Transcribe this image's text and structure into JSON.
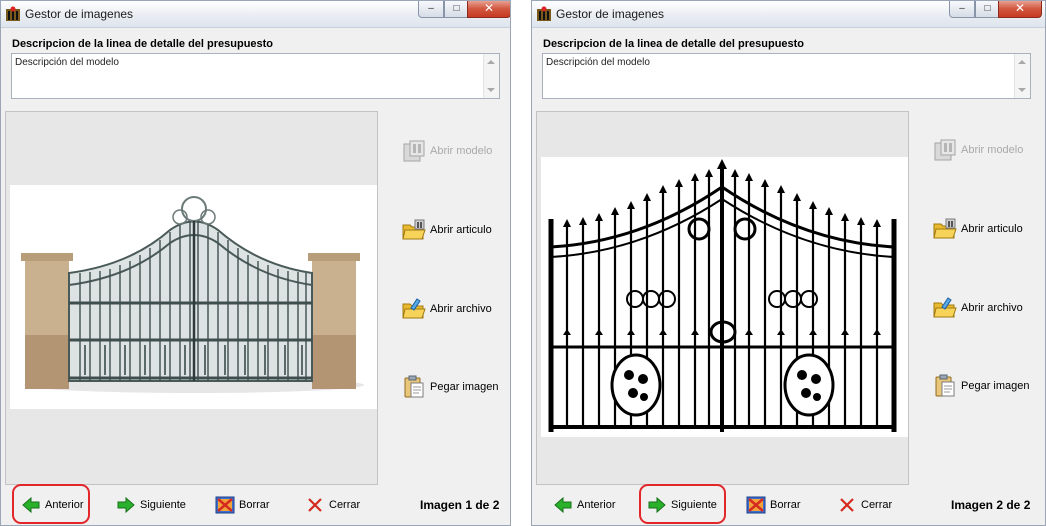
{
  "windows": [
    {
      "title": "Gestor de imagenes",
      "description_label": "Descripcion de la linea de detalle del presupuesto",
      "description_text": "Descripción del modelo",
      "side_buttons": [
        {
          "label": "Abrir modelo",
          "icon": "open-model-icon",
          "enabled": false
        },
        {
          "label": "Abrir articulo",
          "icon": "open-article-folder-icon",
          "enabled": true
        },
        {
          "label": "Abrir archivo",
          "icon": "open-file-folder-icon",
          "enabled": true
        },
        {
          "label": "Pegar imagen",
          "icon": "paste-clipboard-icon",
          "enabled": true
        }
      ],
      "bottom_buttons": [
        {
          "label": "Anterior",
          "icon": "green-arrow-left-icon"
        },
        {
          "label": "Siguiente",
          "icon": "green-arrow-right-icon"
        },
        {
          "label": "Borrar",
          "icon": "delete-image-icon"
        },
        {
          "label": "Cerrar",
          "icon": "red-x-icon"
        }
      ],
      "highlighted_button": "Anterior",
      "image_counter": "Imagen 1 de 2",
      "image": "stone-pillar-iron-gate-photo"
    },
    {
      "title": "Gestor de imagenes",
      "description_label": "Descripcion de la linea de detalle del presupuesto",
      "description_text": "Descripción del modelo",
      "side_buttons": [
        {
          "label": "Abrir modelo",
          "icon": "open-model-icon",
          "enabled": false
        },
        {
          "label": "Abrir articulo",
          "icon": "open-article-folder-icon",
          "enabled": true
        },
        {
          "label": "Abrir archivo",
          "icon": "open-file-folder-icon",
          "enabled": true
        },
        {
          "label": "Pegar imagen",
          "icon": "paste-clipboard-icon",
          "enabled": true
        }
      ],
      "bottom_buttons": [
        {
          "label": "Anterior",
          "icon": "green-arrow-left-icon"
        },
        {
          "label": "Siguiente",
          "icon": "green-arrow-right-icon"
        },
        {
          "label": "Borrar",
          "icon": "delete-image-icon"
        },
        {
          "label": "Cerrar",
          "icon": "red-x-icon"
        }
      ],
      "highlighted_button": "Siguiente",
      "image_counter": "Imagen 2 de 2",
      "image": "black-wrought-iron-gate-drawing"
    }
  ],
  "caption_buttons": {
    "minimize": "–",
    "maximize": "□",
    "close": "✕"
  },
  "colors": {
    "highlight": "#e3262a",
    "arrow_green": "#29b12c",
    "close_red": "#d42a1f"
  }
}
